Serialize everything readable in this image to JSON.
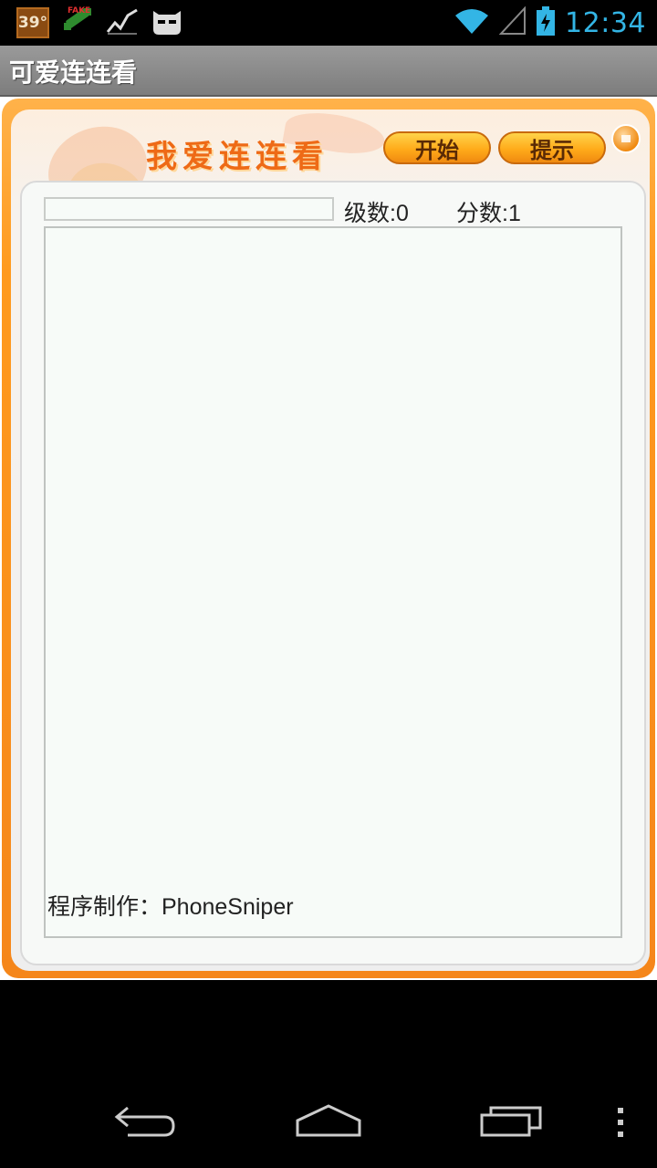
{
  "status_bar": {
    "temperature": "39°",
    "time": "12:34",
    "icons": [
      "weather-icon",
      "fake-gps-icon",
      "activity-graph-icon",
      "cyanogen-icon",
      "wifi-icon",
      "signal-icon",
      "battery-charging-icon"
    ]
  },
  "app_bar": {
    "title": "可爱连连看"
  },
  "game": {
    "banner_title": "我爱连连看",
    "start_label": "开始",
    "hint_label": "提示",
    "level_text": "级数:0",
    "score_text": "分数:1",
    "progress": 0,
    "credit": "程序制作：PhoneSniper"
  },
  "nav": {
    "icons": [
      "back-icon",
      "home-icon",
      "recents-icon",
      "overflow-menu-icon"
    ]
  },
  "colors": {
    "accent": "#33b5e5",
    "frame_orange": "#f5861a",
    "button_gold": "#ffab1a"
  }
}
